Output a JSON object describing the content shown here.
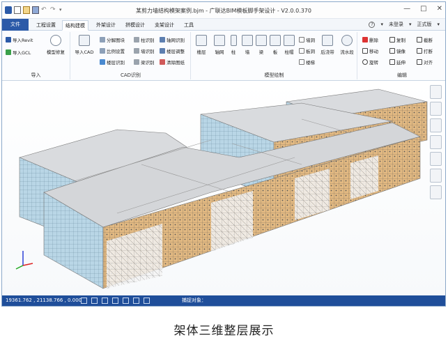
{
  "window": {
    "title": "某剪力墙结构模架案例.bjm - 广联达BIM模板脚手架设计 - V2.0.0.370",
    "controls": [
      "—",
      "□",
      "✕"
    ]
  },
  "tabs": {
    "file": "文件",
    "items": [
      "工程设置",
      "结构建模",
      "外架设计",
      "拼模设计",
      "支架设计",
      "工具"
    ],
    "active": "结构建模",
    "help": "?",
    "login": "未登录",
    "edition": "正式版"
  },
  "ribbon": {
    "import": {
      "label": "导入",
      "revit": "导入Revit",
      "gcl": "导入GCL",
      "repair": "模型修复"
    },
    "cad": {
      "label": "CAD识别",
      "import_cad": "导入CAD",
      "split": "分解图块",
      "scale": "比例设置",
      "floor": "楼层识别",
      "col": "柱识别",
      "wall": "墙识别",
      "beam": "梁识别",
      "axis": "轴网识别",
      "floor_adj": "楼层调整",
      "clear": "清除图纸"
    },
    "model": {
      "label": "模型绘制",
      "floor": "楼层",
      "axis": "轴网",
      "column": "柱",
      "wall": "墙",
      "beam": "梁",
      "slab": "板",
      "capital": "柱帽",
      "wall_hole": "墙洞",
      "slab_hole": "板洞",
      "stair": "楼梯",
      "post_pour": "后浇带",
      "water": "流水段"
    },
    "edit": {
      "label": "编辑",
      "delete": "删除",
      "copy": "复制",
      "cut": "截断",
      "move": "移动",
      "mirror": "镜像",
      "break": "打断",
      "rotate": "旋转",
      "extend": "延伸",
      "align": "对齐"
    }
  },
  "status": {
    "coords": "19361.762 , 21138.766 , 0.000",
    "capture": "捕捉对象："
  },
  "caption": "架体三维整层展示",
  "icons": [
    "app-logo-icon",
    "new-icon",
    "open-icon",
    "save-icon",
    "undo-icon",
    "redo-icon",
    "dropdown-icon"
  ],
  "colors": {
    "file_tab": "#2b5aa8",
    "status_bar": "#1f4e9a",
    "facade": "#e2b982",
    "glass": "#b9d6e6",
    "roof": "#d9dbde"
  }
}
